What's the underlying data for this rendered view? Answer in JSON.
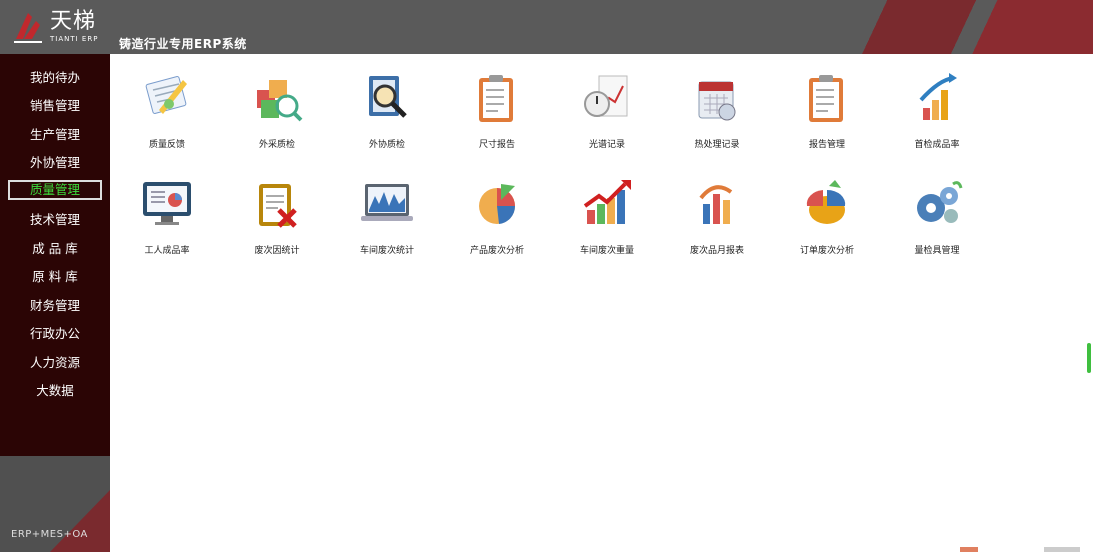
{
  "header": {
    "logo_cn": "天梯",
    "logo_en": "TIANTI ERP",
    "app_title": "铸造行业专用ERP系统"
  },
  "sidebar": {
    "items": [
      {
        "label": "我的待办",
        "active": false
      },
      {
        "label": "销售管理",
        "active": false
      },
      {
        "label": "生产管理",
        "active": false
      },
      {
        "label": "外协管理",
        "active": false
      },
      {
        "label": "质量管理",
        "active": true
      },
      {
        "label": "技术管理",
        "active": false
      },
      {
        "label": "成 品 库",
        "active": false
      },
      {
        "label": "原 料 库",
        "active": false
      },
      {
        "label": "财务管理",
        "active": false
      },
      {
        "label": "行政办公",
        "active": false
      },
      {
        "label": "人力资源",
        "active": false
      },
      {
        "label": "大数据",
        "active": false
      }
    ],
    "footer": "ERP+MES+OA"
  },
  "modules": [
    {
      "label": "质量反馈",
      "icon": "feedback-note-icon"
    },
    {
      "label": "外采质检",
      "icon": "boxes-inspect-icon"
    },
    {
      "label": "外协质检",
      "icon": "magnifier-clipboard-icon"
    },
    {
      "label": "尺寸报告",
      "icon": "clipboard-report-icon"
    },
    {
      "label": "光谱记录",
      "icon": "stopwatch-chart-icon"
    },
    {
      "label": "热处理记录",
      "icon": "calendar-icon"
    },
    {
      "label": "报告管理",
      "icon": "clipboard-report-icon"
    },
    {
      "label": "首检成品率",
      "icon": "rising-bars-icon"
    },
    {
      "label": "工人成品率",
      "icon": "monitor-chart-icon"
    },
    {
      "label": "废次因统计",
      "icon": "clipboard-reject-icon"
    },
    {
      "label": "车间废次统计",
      "icon": "laptop-chart-icon"
    },
    {
      "label": "产品废次分析",
      "icon": "pie-chart-icon"
    },
    {
      "label": "车间废次重量",
      "icon": "growth-arrow-icon"
    },
    {
      "label": "废次品月报表",
      "icon": "bar-arrow-icon"
    },
    {
      "label": "订单废次分析",
      "icon": "pie-3d-icon"
    },
    {
      "label": "量检具管理",
      "icon": "gears-icon"
    }
  ],
  "colors": {
    "header_bg": "#5a5a5a",
    "sidebar_bg": "#2b0505",
    "active_text": "#3cdc3c",
    "accent_red": "#8b2b30"
  }
}
